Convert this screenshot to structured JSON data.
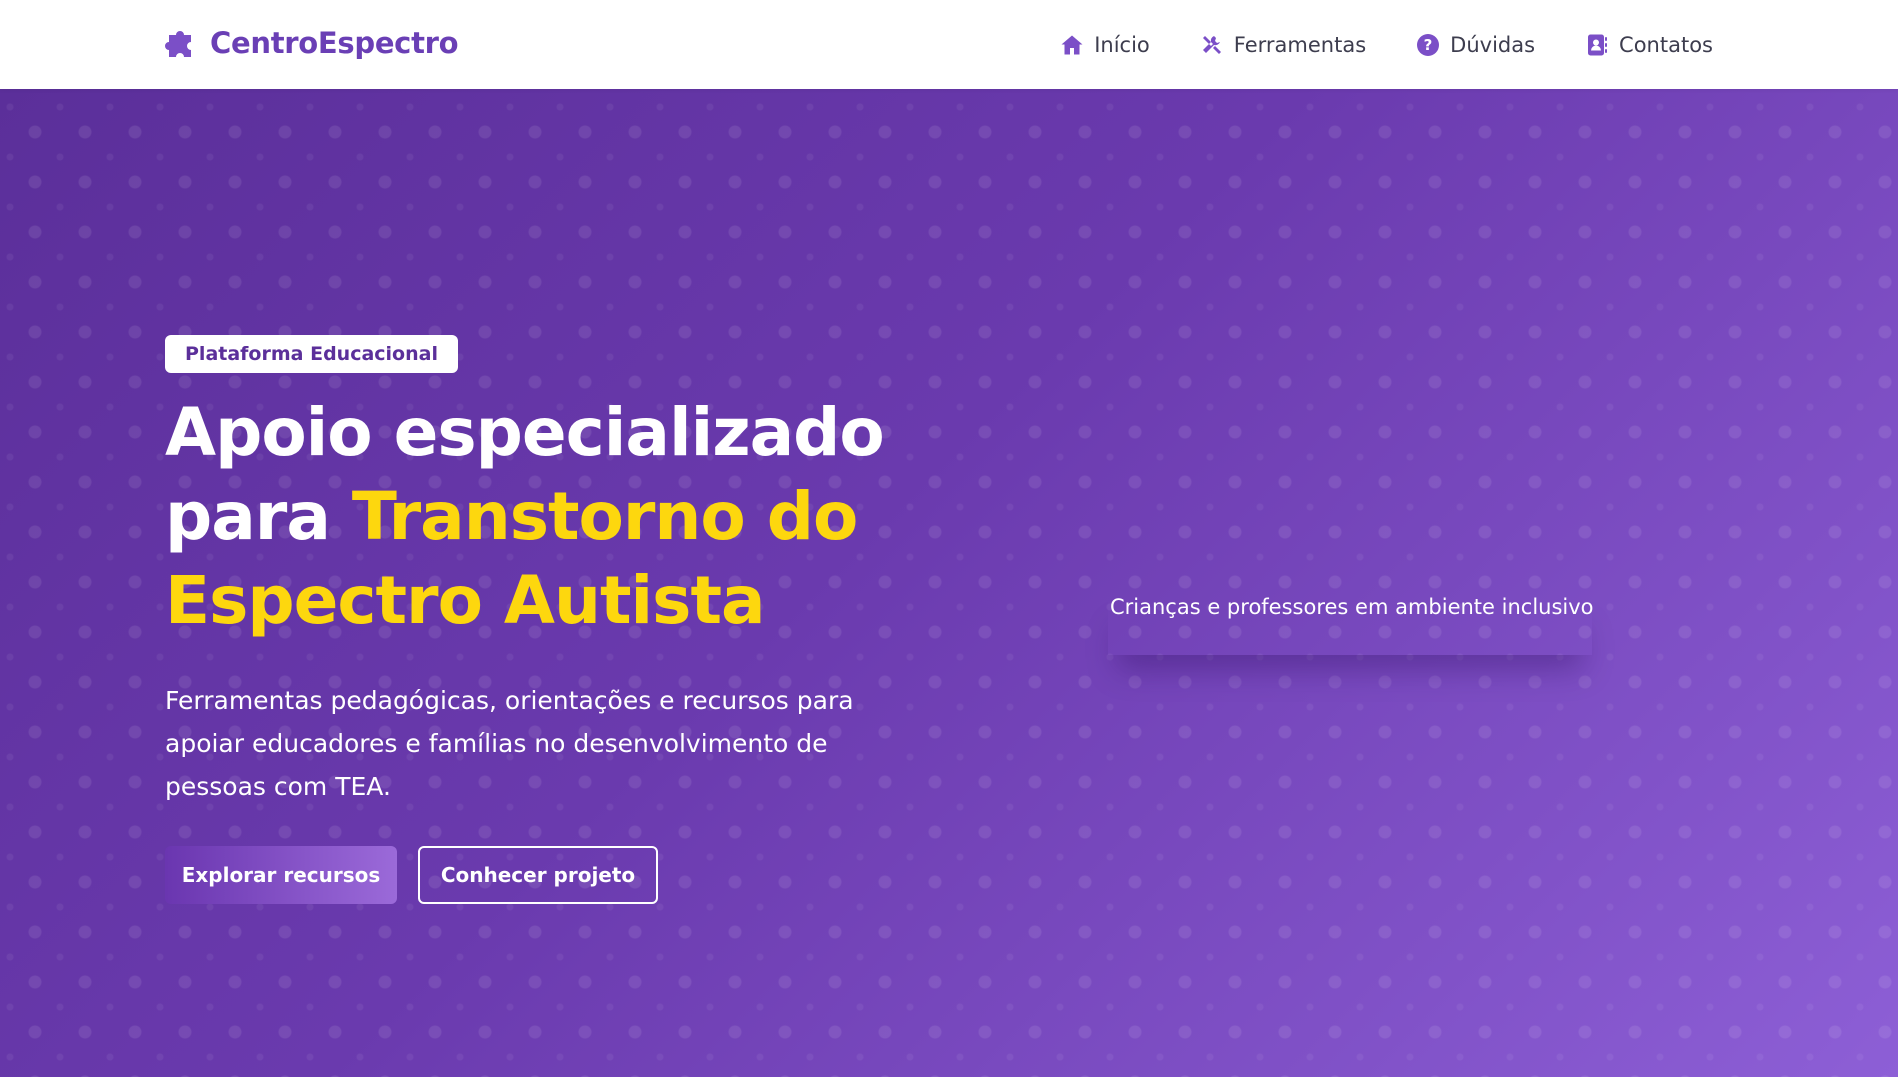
{
  "brand": {
    "name": "CentroEspectro",
    "icon": "puzzle-icon"
  },
  "nav": {
    "items": [
      {
        "label": "Início",
        "icon": "home-icon"
      },
      {
        "label": "Ferramentas",
        "icon": "tools-icon"
      },
      {
        "label": "Dúvidas",
        "icon": "question-icon"
      },
      {
        "label": "Contatos",
        "icon": "contact-book-icon"
      }
    ]
  },
  "hero": {
    "badge": "Plataforma Educacional",
    "headline_part1": "Apoio especializado para ",
    "headline_highlight": "Transtorno do Espectro Autista",
    "subtitle": "Ferramentas pedagógicas, orientações e recursos para apoiar educadores e famílias no desenvolvimento de pessoas com TEA.",
    "primary_button": "Explorar recursos",
    "secondary_button": "Conhecer projeto",
    "image_alt": "Crianças e professores em ambiente inclusivo"
  },
  "colors": {
    "brand_purple": "#6a3fb5",
    "hero_gradient_start": "#5b2f9a",
    "hero_gradient_end": "#8d5fd6",
    "highlight_yellow": "#fdd70e",
    "nav_text": "#3d3d4e"
  }
}
